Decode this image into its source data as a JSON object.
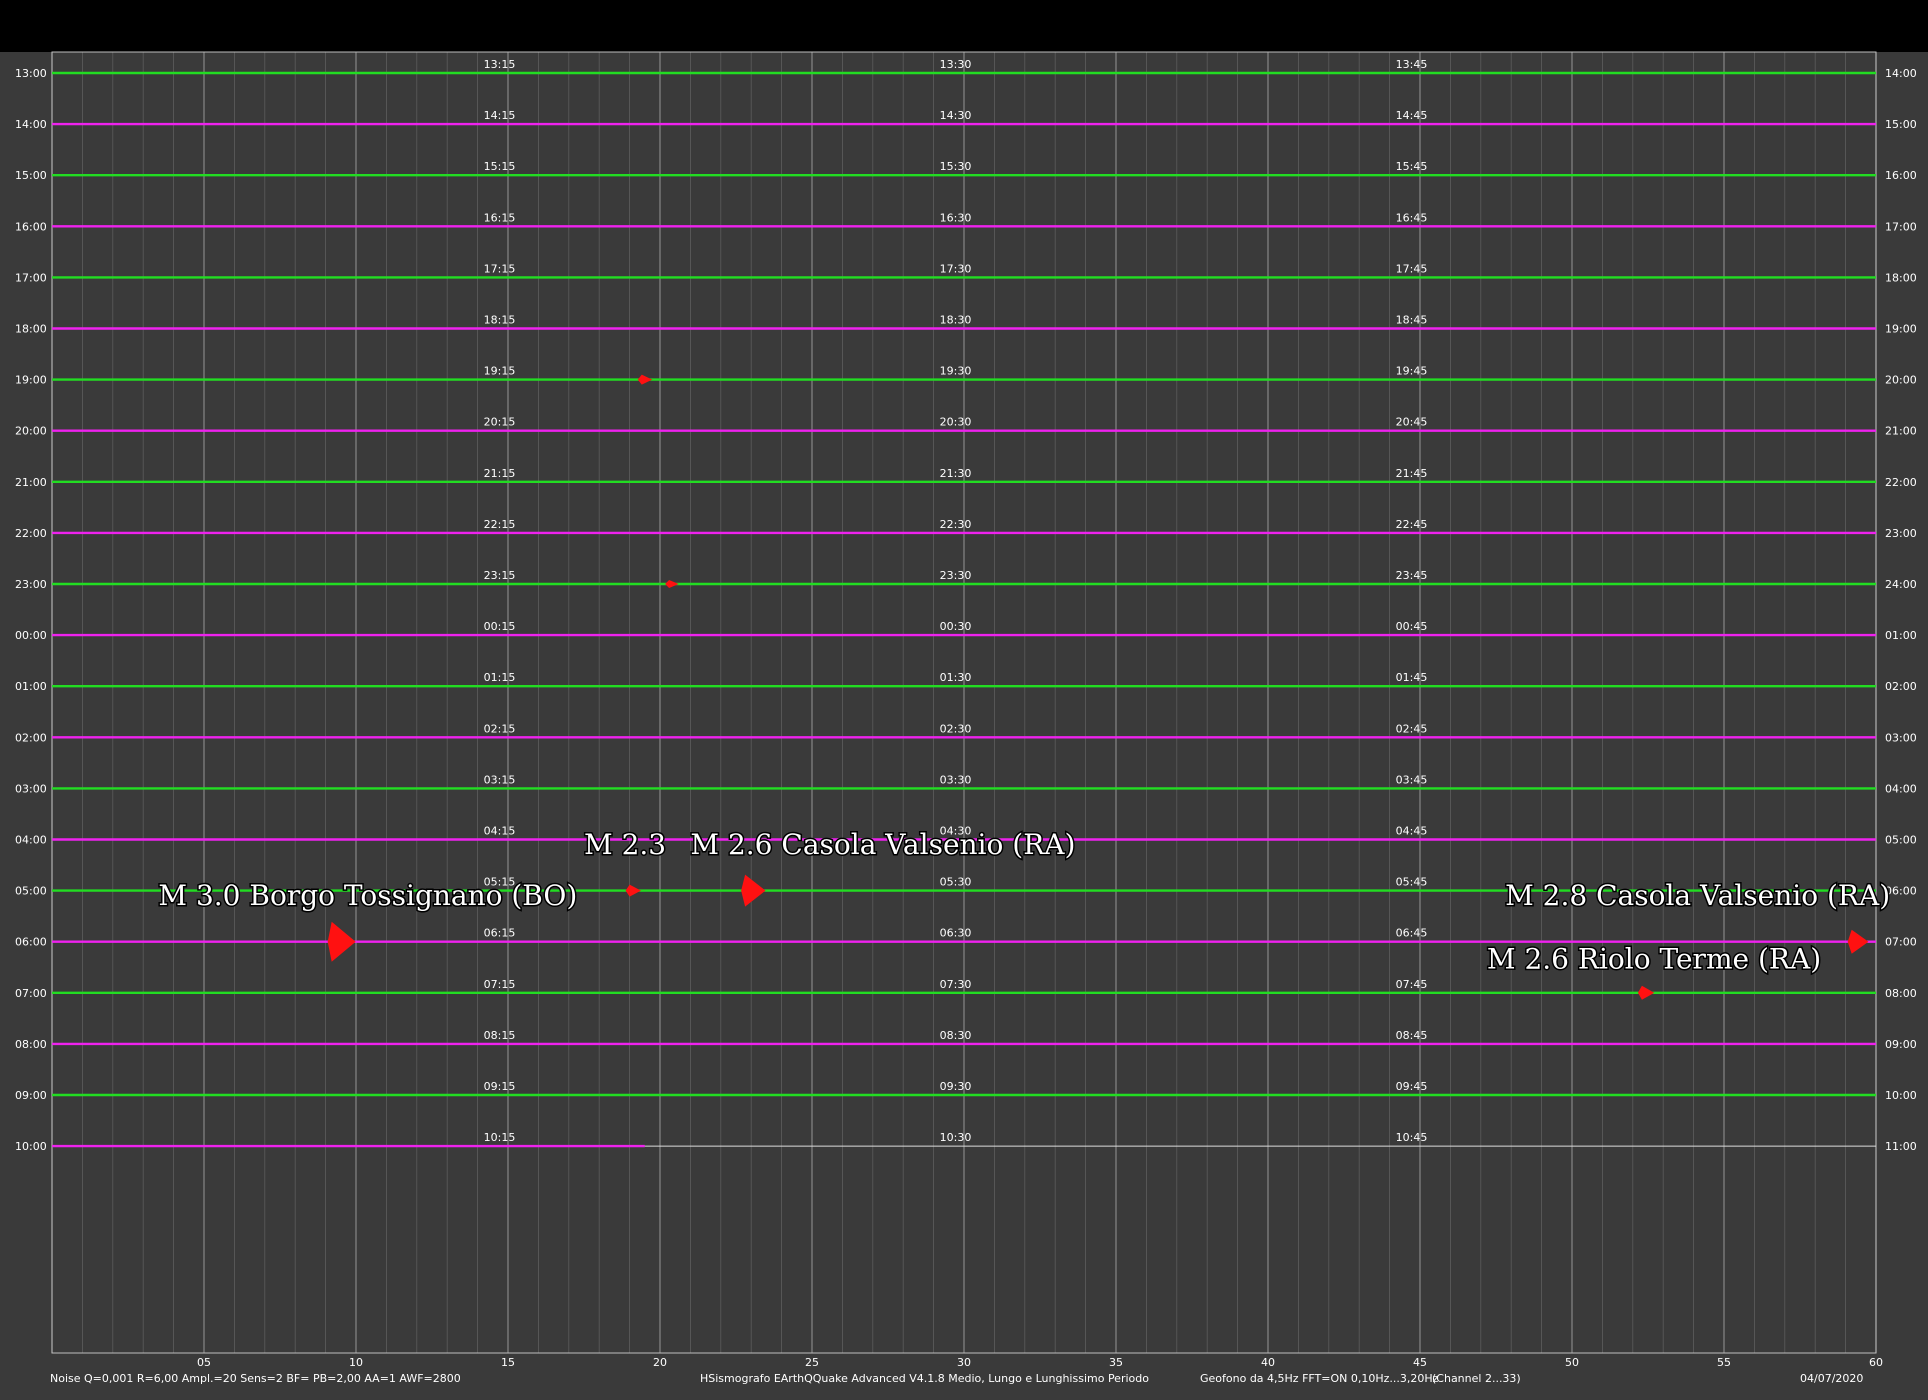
{
  "window": {
    "app_footer": "HSismografo  EArthQQuake Advanced V4.1.8  Medio, Lungo e Lunghissimo Periodo",
    "noise_footer": "Noise Q=0,001 R=6,00 Ampl.=20 Sens=2 BF= PB=2,00 AA=1 AWF=2800",
    "sensor_footer": "Geofono da 4,5Hz FFT=ON 0,10Hz...3,20Hz",
    "channel_footer": "(Channel 2...33)",
    "date_footer": "04/07/2020"
  },
  "colors": {
    "background": "#3a3a3a",
    "trace_green": "#22dd22",
    "trace_magenta": "#ee22ee",
    "event_red": "#ff1111",
    "grid": "#8a8a8a",
    "text": "#ffffff"
  },
  "chart_data": {
    "type": "helicorder",
    "minutes_per_line": 60,
    "x_tick_labels": [
      "05",
      "10",
      "15",
      "20",
      "25",
      "30",
      "35",
      "40",
      "45",
      "50",
      "55",
      "60"
    ],
    "left_labels": [
      "13:00",
      "14:00",
      "15:00",
      "16:00",
      "17:00",
      "18:00",
      "19:00",
      "20:00",
      "21:00",
      "22:00",
      "23:00",
      "00:00",
      "01:00",
      "02:00",
      "03:00",
      "04:00",
      "05:00",
      "06:00",
      "07:00",
      "08:00",
      "09:00",
      "10:00"
    ],
    "right_labels": [
      "14:00",
      "15:00",
      "16:00",
      "17:00",
      "18:00",
      "19:00",
      "20:00",
      "21:00",
      "22:00",
      "23:00",
      "24:00",
      "01:00",
      "02:00",
      "03:00",
      "04:00",
      "05:00",
      "06:00",
      "07:00",
      "08:00",
      "09:00",
      "10:00",
      "11:00"
    ],
    "quarter_labels": {
      "q15": [
        "13:15",
        "14:15",
        "15:15",
        "16:15",
        "17:15",
        "18:15",
        "19:15",
        "20:15",
        "21:15",
        "22:15",
        "23:15",
        "00:15",
        "01:15",
        "02:15",
        "03:15",
        "04:15",
        "05:15",
        "06:15",
        "07:15",
        "08:15",
        "09:15",
        "10:15"
      ],
      "q30": [
        "13:30",
        "14:30",
        "15:30",
        "16:30",
        "17:30",
        "18:30",
        "19:30",
        "20:30",
        "21:30",
        "22:30",
        "23:30",
        "00:30",
        "01:30",
        "02:30",
        "03:30",
        "04:30",
        "05:30",
        "06:30",
        "07:30",
        "08:30",
        "09:30",
        "10:30"
      ],
      "q45": [
        "13:45",
        "14:45",
        "15:45",
        "16:45",
        "17:45",
        "18:45",
        "19:45",
        "20:45",
        "21:45",
        "22:45",
        "23:45",
        "00:45",
        "01:45",
        "02:45",
        "03:45",
        "04:45",
        "05:45",
        "06:45",
        "07:45",
        "08:45",
        "09:45",
        "10:45"
      ]
    },
    "last_line_end_minute": 19.5,
    "events": [
      {
        "line": 6,
        "minute": 19.4,
        "amp": 5
      },
      {
        "line": 10,
        "minute": 20.3,
        "amp": 4
      },
      {
        "line": 16,
        "minute": 19.0,
        "amp": 6
      },
      {
        "line": 16,
        "minute": 22.8,
        "amp": 16
      },
      {
        "line": 17,
        "minute": 9.2,
        "amp": 20
      },
      {
        "line": 17,
        "minute": 59.2,
        "amp": 12
      },
      {
        "line": 18,
        "minute": 52.3,
        "amp": 7
      }
    ],
    "annotations": [
      {
        "text": "M 2.3",
        "line": 16,
        "minute": 17.5,
        "row_offset": -0.72
      },
      {
        "text": "M 2.6  Casola Valsenio (RA)",
        "line": 16,
        "minute": 21.0,
        "row_offset": -0.72
      },
      {
        "text": "M 3.0 Borgo Tossignano (BO)",
        "line": 17,
        "minute": 3.5,
        "row_offset": -0.72
      },
      {
        "text": "M 2.8 Casola Valsenio (RA)",
        "line": 17,
        "minute": 47.8,
        "row_offset": -0.72
      },
      {
        "text": "M 2.6 Riolo Terme (RA)",
        "line": 18,
        "minute": 47.2,
        "row_offset": -0.48
      }
    ]
  }
}
